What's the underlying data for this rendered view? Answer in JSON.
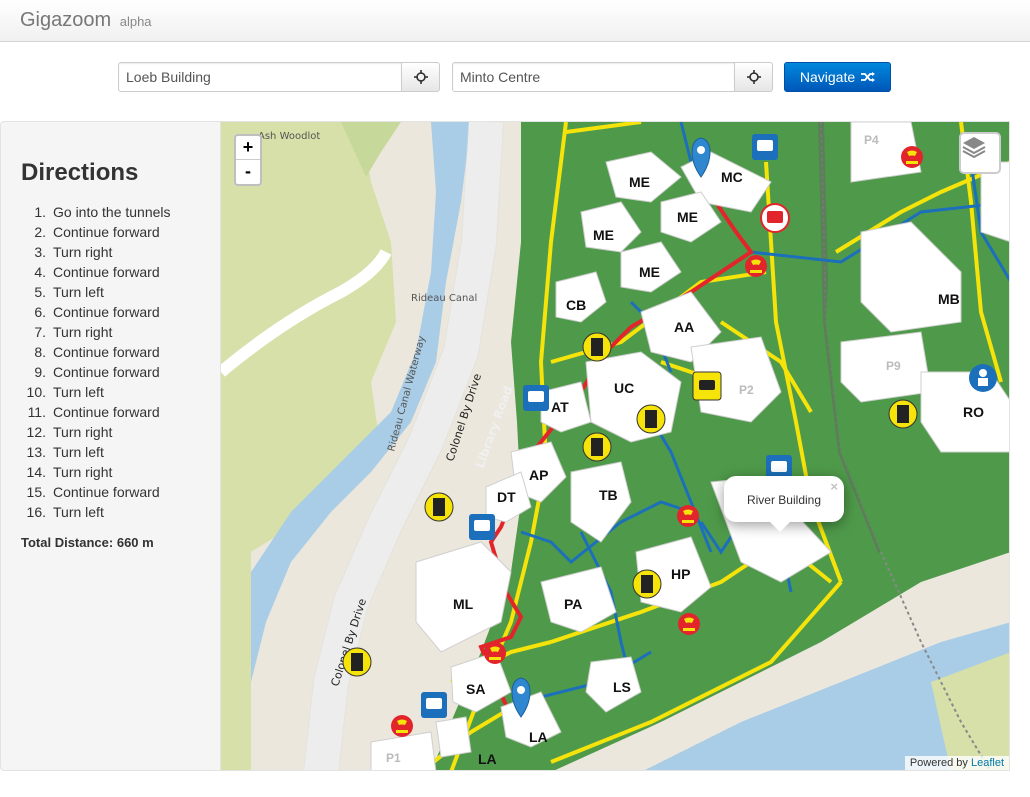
{
  "app": {
    "title": "Gigazoom",
    "subtitle": "alpha"
  },
  "search": {
    "origin_value": "Loeb Building",
    "destination_value": "Minto Centre",
    "navigate_label": "Navigate"
  },
  "directions": {
    "title": "Directions",
    "steps": [
      "Go into the tunnels",
      "Continue forward",
      "Turn right",
      "Continue forward",
      "Turn left",
      "Continue forward",
      "Turn right",
      "Continue forward",
      "Continue forward",
      "Turn left",
      "Continue forward",
      "Turn right",
      "Turn left",
      "Turn right",
      "Continue forward",
      "Turn left"
    ],
    "total_label": "Total Distance:",
    "total_value": "660 m"
  },
  "map": {
    "zoom_in": "+",
    "zoom_out": "-",
    "popup_text": "River Building",
    "popup_close": "×",
    "attribution_prefix": "Powered by",
    "attribution_link": "Leaflet",
    "labels": {
      "ash_woodlot": "Ash Woodlot",
      "rideau_canal": "Rideau Canal",
      "rideau_canal_waterway": "Rideau Canal Waterway",
      "colonel_by_drive": "Colonel By Drive",
      "colonel_by_drive_2": "Colonel By Drive",
      "library_road": "Library Road"
    },
    "buildings": {
      "me1": "ME",
      "me2": "ME",
      "me3": "ME",
      "me4": "ME",
      "mc": "MC",
      "cb": "CB",
      "aa": "AA",
      "uc": "UC",
      "at": "AT",
      "ap": "AP",
      "dt": "DT",
      "tb": "TB",
      "ml": "ML",
      "pa": "PA",
      "hp": "HP",
      "sa": "SA",
      "la": "LA",
      "la2": "LA",
      "ls": "LS",
      "mb": "MB",
      "ro": "RO",
      "p1": "P1",
      "p2": "P2",
      "p4": "P4",
      "p9": "P9"
    },
    "colors": {
      "grass": "#4f9a4a",
      "route": "#e2252b",
      "tunnel": "#1c6fba",
      "path": "#f5e30a",
      "water": "#a9cde6"
    }
  }
}
